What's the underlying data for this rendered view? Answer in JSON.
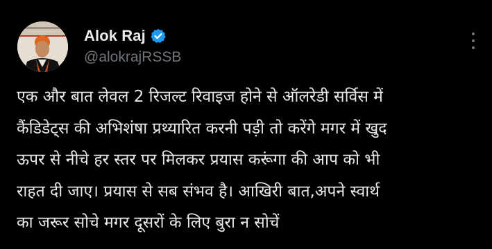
{
  "author": {
    "display_name": "Alok Raj",
    "handle": "@alokrajRSSB",
    "verified_badge_icon": "verified-badge-icon",
    "badge_color": "#1d9bf0"
  },
  "menu_icon": "more-options-icon",
  "tweet": {
    "lines": [
      "एक और बात लेवल 2 रिजल्ट रिवाइज होने से ऑलरेडी सर्विस में",
      "कैंडिडेट्स की अभिशंषा प्रथ्यारित करनी पड़ी तो करेंगे मगर में खुद",
      "ऊपर से नीचे हर स्तर पर मिलकर प्रयास करूंगा की आप को भी",
      "राहत दी जाए।  प्रयास से सब संभव है। आखिरी बात,अपने स्वार्थ",
      "का जरूर सोचे मगर दूसरों के लिए बुरा न सोचें"
    ]
  },
  "colors": {
    "background": "#000000",
    "primary_text": "#e7e9ea",
    "secondary_text": "#71767b"
  }
}
